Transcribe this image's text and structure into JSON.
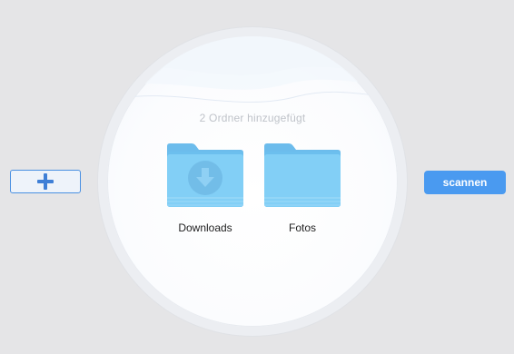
{
  "scan": {
    "status": "2 Ordner hinzugefügt",
    "folders": [
      {
        "label": "Downloads",
        "icon": "folder-download-icon"
      },
      {
        "label": "Fotos",
        "icon": "folder-icon"
      }
    ]
  },
  "toolbar": {
    "add_icon": "plus-icon",
    "scan_label": "scannen"
  },
  "colors": {
    "accent": "#4a9af0",
    "folder": "#7ecbf5",
    "background": "#e5e5e7"
  }
}
